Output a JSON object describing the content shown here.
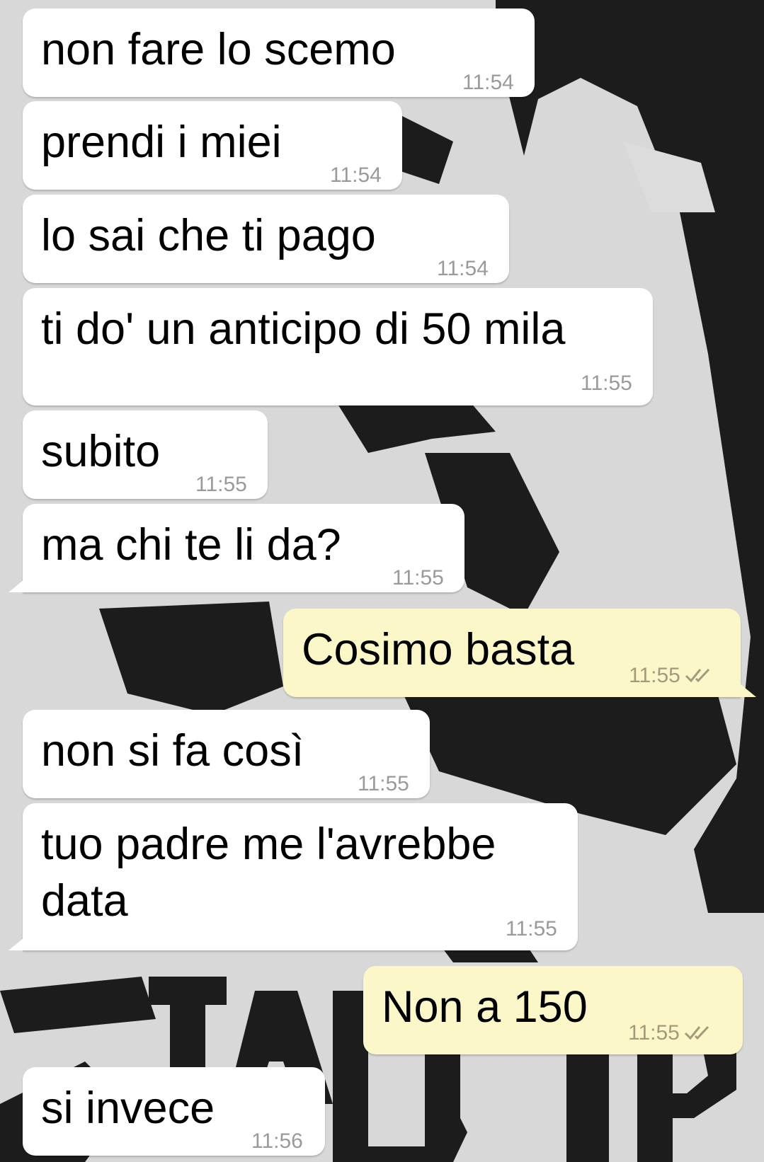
{
  "messages": [
    {
      "direction": "in",
      "text": "non fare lo scemo",
      "time": "11:54"
    },
    {
      "direction": "in",
      "text": "prendi i miei",
      "time": "11:54"
    },
    {
      "direction": "in",
      "text": "lo sai che ti pago",
      "time": "11:54"
    },
    {
      "direction": "in",
      "text": "ti do' un anticipo di 50 mila",
      "time": "11:55"
    },
    {
      "direction": "in",
      "text": "subito",
      "time": "11:55"
    },
    {
      "direction": "in",
      "text": "ma chi te li da?",
      "time": "11:55"
    },
    {
      "direction": "out",
      "text": "Cosimo basta",
      "time": "11:55",
      "status": "read"
    },
    {
      "direction": "in",
      "text": "non si fa così",
      "time": "11:55"
    },
    {
      "direction": "in",
      "text": "tuo padre me l'avrebbe\ndata",
      "time": "11:55"
    },
    {
      "direction": "out",
      "text": "Non a 150",
      "time": "11:55",
      "status": "read"
    },
    {
      "direction": "in",
      "text": "si invece",
      "time": "11:56"
    }
  ],
  "wallpaper": {
    "description_icon": "stencil-portrait-wallpaper",
    "watermark_text": "STALUP"
  },
  "colors": {
    "incoming_bubble": "#ffffff",
    "outgoing_bubble": "#fcf7c8",
    "timestamp": "#9a9a9a",
    "read_ticks": "#a39a7e"
  }
}
